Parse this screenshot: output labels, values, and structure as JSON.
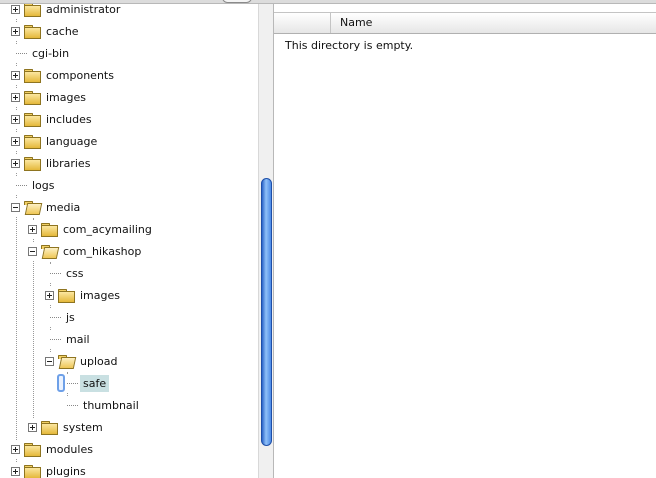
{
  "tree": {
    "items": [
      {
        "label": "administrator",
        "level": 0,
        "type": "folder",
        "toggle": "plus"
      },
      {
        "label": "cache",
        "level": 0,
        "type": "folder",
        "toggle": "plus"
      },
      {
        "label": "cgi-bin",
        "level": 0,
        "type": "leaf"
      },
      {
        "label": "components",
        "level": 0,
        "type": "folder",
        "toggle": "plus"
      },
      {
        "label": "images",
        "level": 0,
        "type": "folder",
        "toggle": "plus"
      },
      {
        "label": "includes",
        "level": 0,
        "type": "folder",
        "toggle": "plus"
      },
      {
        "label": "language",
        "level": 0,
        "type": "folder",
        "toggle": "plus"
      },
      {
        "label": "libraries",
        "level": 0,
        "type": "folder",
        "toggle": "plus"
      },
      {
        "label": "logs",
        "level": 0,
        "type": "leaf"
      },
      {
        "label": "media",
        "level": 0,
        "type": "folder-open",
        "toggle": "minus"
      },
      {
        "label": "com_acymailing",
        "level": 1,
        "type": "folder",
        "toggle": "plus"
      },
      {
        "label": "com_hikashop",
        "level": 1,
        "type": "folder-open",
        "toggle": "minus"
      },
      {
        "label": "css",
        "level": 2,
        "type": "leaf"
      },
      {
        "label": "images",
        "level": 2,
        "type": "folder",
        "toggle": "plus"
      },
      {
        "label": "js",
        "level": 2,
        "type": "leaf"
      },
      {
        "label": "mail",
        "level": 2,
        "type": "leaf"
      },
      {
        "label": "upload",
        "level": 2,
        "type": "folder-open",
        "toggle": "minus"
      },
      {
        "label": "safe",
        "level": 3,
        "type": "leaf",
        "selected": true
      },
      {
        "label": "thumbnail",
        "level": 3,
        "type": "leaf"
      },
      {
        "label": "system",
        "level": 1,
        "type": "folder",
        "toggle": "plus"
      },
      {
        "label": "modules",
        "level": 0,
        "type": "folder",
        "toggle": "plus"
      },
      {
        "label": "plugins",
        "level": 0,
        "type": "folder",
        "toggle": "plus"
      }
    ]
  },
  "file_list": {
    "columns": [
      "",
      "Name"
    ],
    "empty_message": "This directory is empty."
  },
  "colors": {
    "selection": "#c9e0e2",
    "scroll_thumb": "#4c8ae6",
    "folder": "#efc755"
  },
  "icons": {
    "folder": "folder-icon",
    "folder_open": "folder-open-icon",
    "expand": "expand-plus-icon",
    "collapse": "collapse-minus-icon"
  }
}
